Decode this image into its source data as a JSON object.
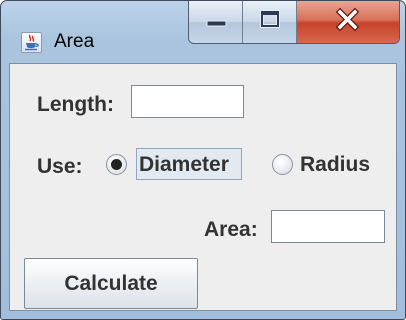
{
  "window": {
    "title": "Area",
    "icon": "java-cup-icon",
    "controls": [
      "minimize-icon",
      "maximize-icon",
      "close-icon"
    ],
    "close_color": "#c7432a"
  },
  "form": {
    "length_label": "Length:",
    "length_value": "",
    "use_label": "Use:",
    "options": [
      {
        "label": "Diameter",
        "selected": true
      },
      {
        "label": "Radius",
        "selected": false
      }
    ],
    "area_label": "Area:",
    "area_value": "",
    "calculate_label": "Calculate"
  }
}
